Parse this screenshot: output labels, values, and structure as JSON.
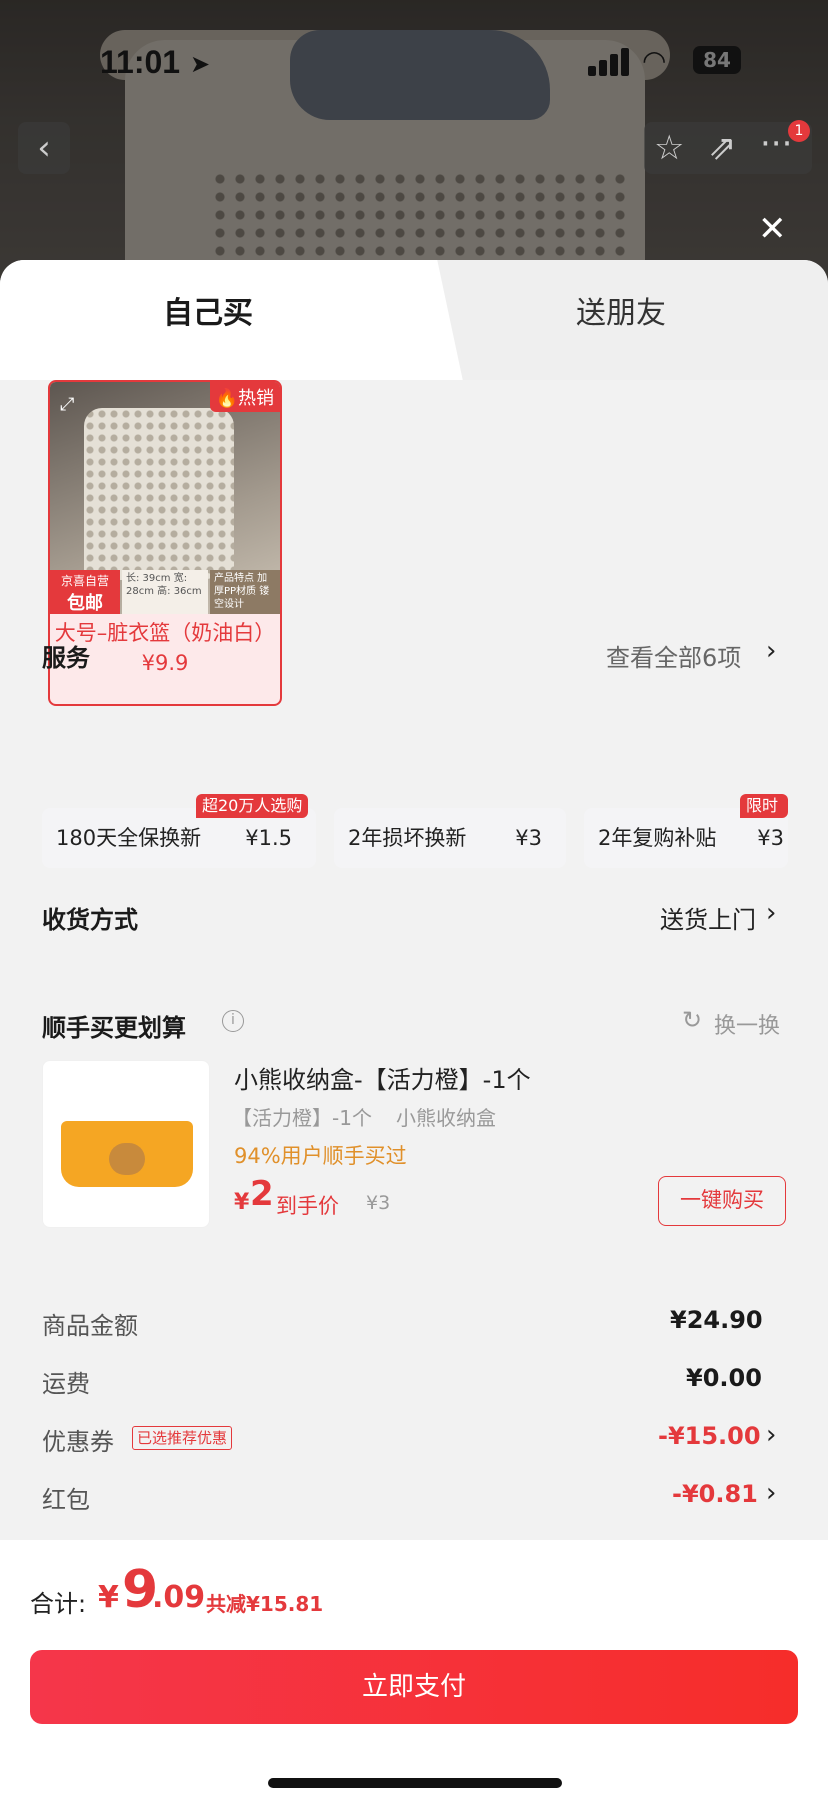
{
  "status_bar": {
    "time": "11:01",
    "battery": "84"
  },
  "nav": {
    "back_icon": "‹",
    "star_icon": "☆",
    "share_icon": "⇗",
    "more_icon": "···",
    "notif_count": "1",
    "close_icon": "✕"
  },
  "tabs": [
    {
      "label": "自己买"
    },
    {
      "label": "送朋友"
    }
  ],
  "product": {
    "hot_badge": "🔥热销",
    "self_line1": "京喜自营",
    "self_line2": "包邮",
    "spec_text": "长: 39cm 宽: 28cm 高: 36cm",
    "feature_text": "产品特点 加厚PP材质 镂空设计",
    "name": "大号–脏衣篮（奶油白） ¥9.9"
  },
  "services": {
    "title": "服务",
    "view_all": "查看全部6项",
    "items": [
      {
        "name": "180天全保换新",
        "price": "¥1.5",
        "tag": "超20万人选购"
      },
      {
        "name": "2年损坏换新",
        "price": "¥3",
        "tag": ""
      },
      {
        "name": "2年复购补贴",
        "price": "¥3",
        "tag": "限时"
      }
    ]
  },
  "delivery": {
    "label": "收货方式",
    "value": "送货上门"
  },
  "addon": {
    "title": "顺手买更划算",
    "swap": "换一换",
    "name": "小熊收纳盒-【活力橙】-1个",
    "variant": "【活力橙】-1个",
    "variant2": "小熊收纳盒",
    "hint": "94%用户顺手买过",
    "price_symbol": "¥",
    "price": "2",
    "price_label": "到手价",
    "orig_price": "¥3",
    "buy_button": "一键购买"
  },
  "summary": {
    "goods_label": "商品金额",
    "goods_value": "¥24.90",
    "shipping_label": "运费",
    "shipping_value": "¥0.00",
    "coupon_label": "优惠券",
    "coupon_tag": "已选推荐优惠",
    "coupon_value": "-¥15.00",
    "redpacket_label": "红包",
    "redpacket_value": "-¥0.81"
  },
  "footer": {
    "total_label": "合计:",
    "total_symbol": "¥",
    "total_int": "9",
    "total_dec": ".09",
    "saved": "共减¥15.81",
    "pay_button": "立即支付"
  },
  "colors": {
    "accent": "#e4393c",
    "orange": "#e0902a"
  }
}
